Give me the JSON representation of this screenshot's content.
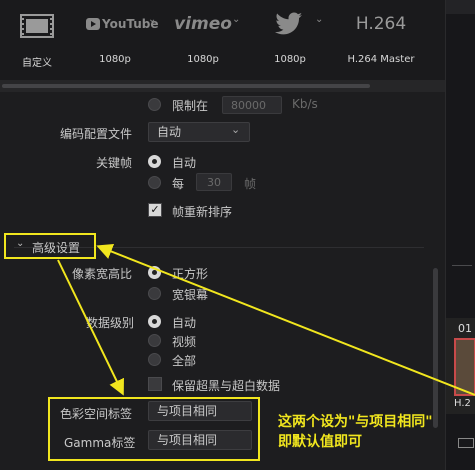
{
  "presets": [
    {
      "id": "custom",
      "label": "自定义",
      "logo": ""
    },
    {
      "id": "youtube",
      "label": "1080p",
      "logo": "YouTube"
    },
    {
      "id": "vimeo",
      "label": "1080p",
      "logo": "vimeo"
    },
    {
      "id": "twitter",
      "label": "1080p",
      "logo": ""
    },
    {
      "id": "h264",
      "label": "H.264 Master",
      "logo": "H.264"
    }
  ],
  "settings": {
    "limit_label": "限制在",
    "limit_value": "80000",
    "limit_unit": "Kb/s",
    "encode_profile_label": "编码配置文件",
    "encode_profile_value": "自动",
    "keyframe_label": "关键帧",
    "keyframe_auto": "自动",
    "keyframe_every": "每",
    "keyframe_value": "30",
    "keyframe_unit": "帧",
    "frame_reorder": "帧重新排序",
    "advanced_settings": "高级设置",
    "pixel_aspect_label": "像素宽高比",
    "pixel_aspect_square": "正方形",
    "pixel_aspect_wide": "宽银幕",
    "data_level_label": "数据级别",
    "data_level_auto": "自动",
    "data_level_video": "视频",
    "data_level_full": "全部",
    "retain_super_label": "保留超黑与超白数据",
    "color_space_label": "色彩空间标签",
    "color_space_value": "与项目相同",
    "gamma_label": "Gamma标签",
    "gamma_value": "与项目相同"
  },
  "annotation": {
    "line1": "这两个设为\"与项目相同\"",
    "line2": "即默认值即可",
    "color": "#f1e61e"
  },
  "right_panel": {
    "clip_number": "01",
    "clip_label": "H.2"
  }
}
